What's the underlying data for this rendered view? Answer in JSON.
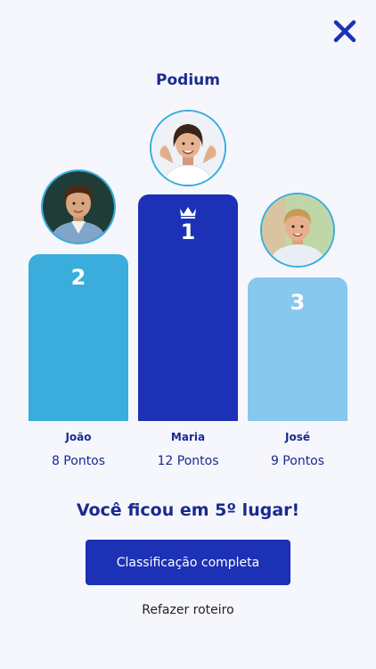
{
  "header": {
    "close_icon": "close-icon",
    "title": "Podium"
  },
  "podium": [
    {
      "rank": "2",
      "name": "João",
      "points": "8 Pontos",
      "avatar_icon": "avatar-boy-curly-hair",
      "bar_color": "#3aaddc"
    },
    {
      "rank": "1",
      "name": "Maria",
      "points": "12 Pontos",
      "avatar_icon": "avatar-girl-smiling",
      "crown_icon": "crown-icon",
      "bar_color": "#1c31b5"
    },
    {
      "rank": "3",
      "name": "José",
      "points": "9 Pontos",
      "avatar_icon": "avatar-boy-blonde",
      "bar_color": "#86c8ee"
    }
  ],
  "result": {
    "message": "Você ficou em 5º lugar!"
  },
  "actions": {
    "full_ranking": "Classificação completa",
    "redo": "Refazer roteiro"
  },
  "colors": {
    "background": "#f6f7fc",
    "primary": "#1c31b5",
    "text_dark_blue": "#1b2a8f"
  }
}
